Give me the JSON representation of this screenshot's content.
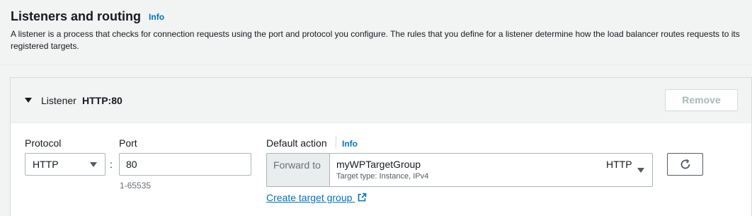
{
  "header": {
    "title": "Listeners and routing",
    "info": "Info",
    "description": "A listener is a process that checks for connection requests using the port and protocol you configure. The rules that you define for a listener determine how the load balancer routes requests to its registered targets."
  },
  "listener": {
    "label": "Listener",
    "value": "HTTP:80",
    "remove_label": "Remove",
    "protocol_label": "Protocol",
    "protocol_value": "HTTP",
    "separator": ":",
    "port_label": "Port",
    "port_value": "80",
    "port_hint": "1-65535",
    "default_action_label": "Default action",
    "default_action_info": "Info",
    "forward_to": "Forward to",
    "target_group_name": "myWPTargetGroup",
    "target_group_details": "Target type: Instance, IPv4",
    "target_group_protocol": "HTTP",
    "create_target_group": "Create target group"
  },
  "icons": {
    "expand": "caret-down-icon",
    "select": "caret-down-icon",
    "refresh": "refresh-icon",
    "external": "external-link-icon"
  },
  "colors": {
    "link": "#0073bb",
    "background": "#f2f3f3",
    "border": "#aab7b8"
  }
}
